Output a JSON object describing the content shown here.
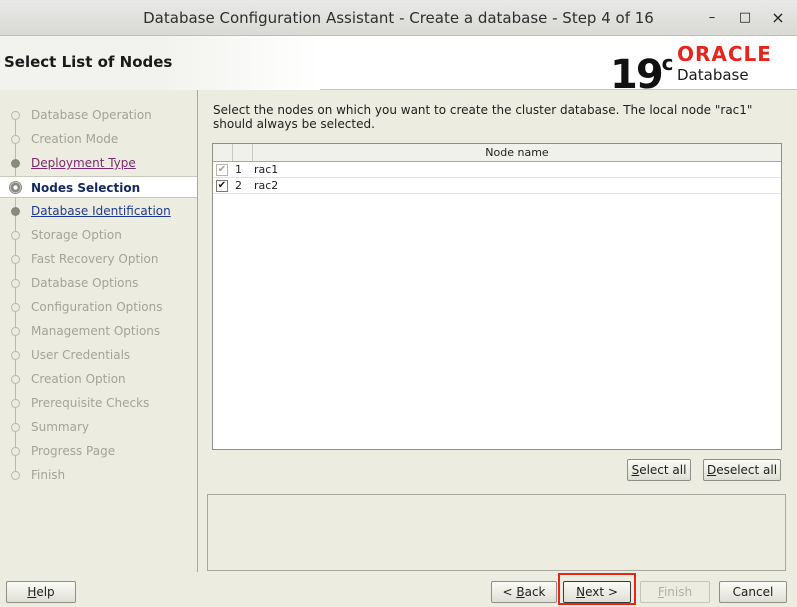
{
  "window": {
    "title": "Database Configuration Assistant - Create a database - Step 4 of 16",
    "controls": {
      "minimize": "–",
      "maximize": "□",
      "close": "×"
    }
  },
  "header": {
    "title": "Select List of Nodes",
    "logo": {
      "version": "19",
      "version_sup": "c",
      "brand": "ORACLE",
      "product": "Database",
      "brand_color": "#e4261c"
    }
  },
  "steps": [
    {
      "label": "Database Operation",
      "state": "disabled"
    },
    {
      "label": "Creation Mode",
      "state": "disabled"
    },
    {
      "label": "Deployment Type",
      "state": "visited"
    },
    {
      "label": "Nodes Selection",
      "state": "current"
    },
    {
      "label": "Database Identification",
      "state": "next"
    },
    {
      "label": "Storage Option",
      "state": "disabled"
    },
    {
      "label": "Fast Recovery Option",
      "state": "disabled"
    },
    {
      "label": "Database Options",
      "state": "disabled"
    },
    {
      "label": "Configuration Options",
      "state": "disabled"
    },
    {
      "label": "Management Options",
      "state": "disabled"
    },
    {
      "label": "User Credentials",
      "state": "disabled"
    },
    {
      "label": "Creation Option",
      "state": "disabled"
    },
    {
      "label": "Prerequisite Checks",
      "state": "disabled"
    },
    {
      "label": "Summary",
      "state": "disabled"
    },
    {
      "label": "Progress Page",
      "state": "disabled"
    },
    {
      "label": "Finish",
      "state": "disabled"
    }
  ],
  "main": {
    "instructions": "Select the nodes on which you want to create the cluster database. The local node \"rac1\" should always be selected.",
    "table": {
      "header": "Node name",
      "rows": [
        {
          "num": "1",
          "name": "rac1",
          "checked": true,
          "disabled": true
        },
        {
          "num": "2",
          "name": "rac2",
          "checked": true,
          "disabled": false
        }
      ]
    },
    "select_all": {
      "mnemonic": "S",
      "rest": "elect all"
    },
    "deselect_all": {
      "mnemonic": "D",
      "rest": "eselect all"
    }
  },
  "footer": {
    "help": {
      "mnemonic": "H",
      "rest": "elp"
    },
    "back": {
      "prefix": "< ",
      "mnemonic": "B",
      "rest": "ack"
    },
    "next": {
      "mnemonic": "N",
      "rest": "ext >"
    },
    "finish": {
      "mnemonic": "F",
      "rest": "inish"
    },
    "cancel": "Cancel"
  }
}
